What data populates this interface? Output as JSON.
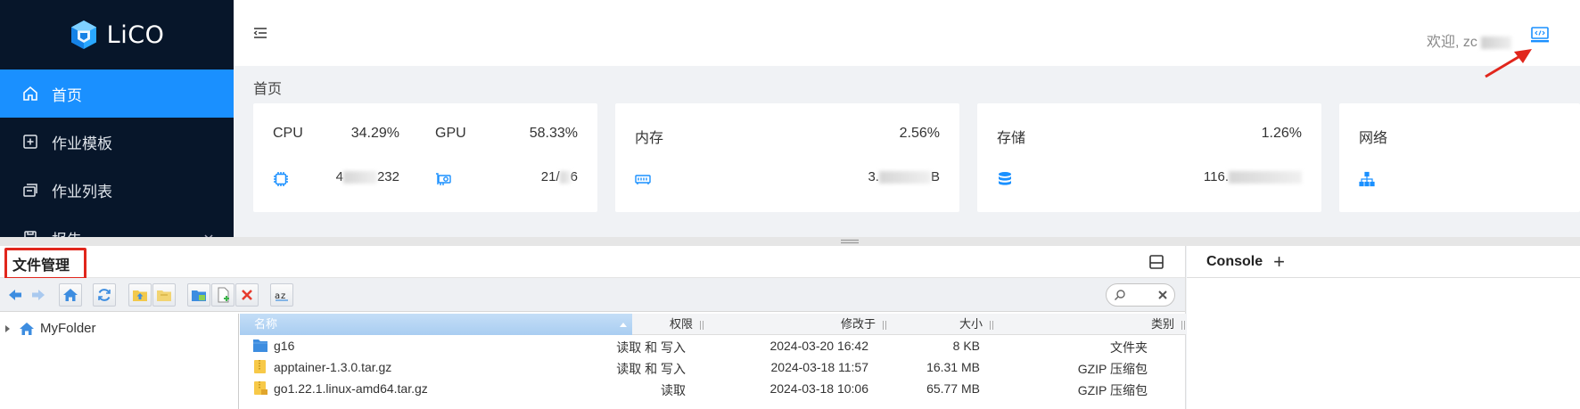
{
  "app": {
    "name": "LiCO"
  },
  "sidebar": {
    "items": [
      {
        "label": "首页",
        "active": true
      },
      {
        "label": "作业模板"
      },
      {
        "label": "作业列表"
      },
      {
        "label": "报告"
      }
    ]
  },
  "header": {
    "welcome": "欢迎, zc"
  },
  "breadcrumb": "首页",
  "stats": {
    "cpu": {
      "label": "CPU",
      "percent": "34.29%",
      "detail": "4",
      "detail_tail": "232"
    },
    "gpu": {
      "label": "GPU",
      "percent": "58.33%",
      "detail": "21/",
      "detail_tail": "6"
    },
    "memory": {
      "label": "内存",
      "percent": "2.56%",
      "detail": "3.",
      "detail_tail": "B"
    },
    "storage": {
      "label": "存储",
      "percent": "1.26%",
      "detail": "116."
    },
    "network": {
      "label": "网络"
    }
  },
  "file_manager": {
    "title": "文件管理",
    "tree_root": "MyFolder",
    "columns": {
      "name": "名称",
      "perm": "权限",
      "modified": "修改于",
      "size": "大小",
      "type": "类别"
    },
    "rows": [
      {
        "name": "g16",
        "perm": "读取 和 写入",
        "modified": "2024-03-20 16:42",
        "size": "8 KB",
        "type": "文件夹",
        "icon": "folder-icon"
      },
      {
        "name": "apptainer-1.3.0.tar.gz",
        "perm": "读取 和 写入",
        "modified": "2024-03-18 11:57",
        "size": "16.31 MB",
        "type": "GZIP 压缩包",
        "icon": "archive-icon"
      },
      {
        "name": "go1.22.1.linux-amd64.tar.gz",
        "perm": "读取",
        "modified": "2024-03-18 10:06",
        "size": "65.77 MB",
        "type": "GZIP 压缩包",
        "icon": "archive-lock-icon"
      }
    ]
  },
  "console": {
    "title": "Console",
    "add": "+"
  },
  "colors": {
    "sidebar_bg": "#07162a",
    "accent": "#1a90ff",
    "highlight_red": "#e1261c"
  }
}
